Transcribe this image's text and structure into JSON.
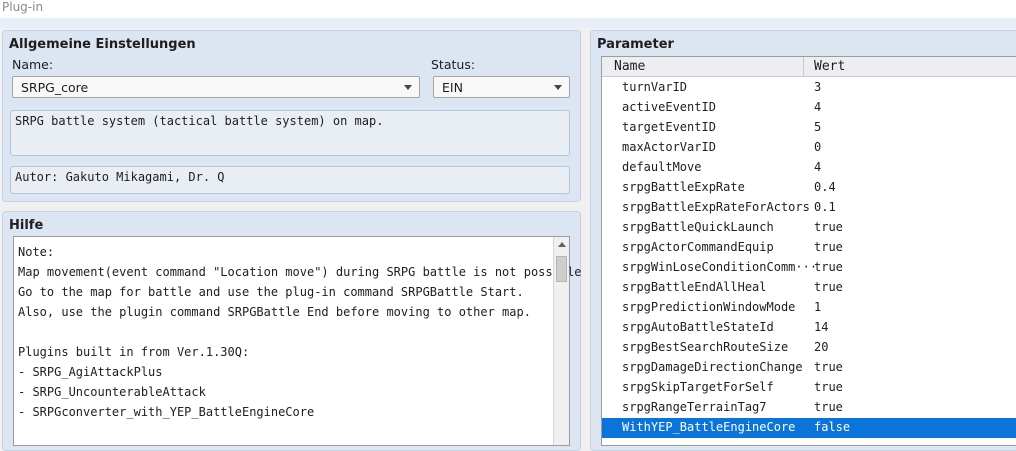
{
  "window": {
    "title": "Plug-in"
  },
  "general": {
    "title": "Allgemeine Einstellungen",
    "name_label": "Name:",
    "name_value": "SRPG_core",
    "status_label": "Status:",
    "status_value": "EIN",
    "description": "SRPG battle system (tactical battle system) on map.",
    "author": "Autor: Gakuto Mikagami, Dr. Q"
  },
  "help": {
    "title": "Hilfe",
    "lines": [
      "Note:",
      "Map movement(event command \"Location move\") during SRPG battle is not possible",
      "Go to the map for battle and use the plug-in command SRPGBattle Start.",
      "Also, use the plugin command SRPGBattle End before moving to other map.",
      "",
      "Plugins built in from Ver.1.30Q:",
      "- SRPG_AgiAttackPlus",
      "- SRPG_UncounterableAttack",
      "- SRPGconverter_with_YEP_BattleEngineCore"
    ]
  },
  "params": {
    "title": "Parameter",
    "col_name": "Name",
    "col_value": "Wert",
    "selected_index": 17,
    "rows": [
      {
        "name": "turnVarID",
        "value": "3"
      },
      {
        "name": "activeEventID",
        "value": "4"
      },
      {
        "name": "targetEventID",
        "value": "5"
      },
      {
        "name": "maxActorVarID",
        "value": "0"
      },
      {
        "name": "defaultMove",
        "value": "4"
      },
      {
        "name": "srpgBattleExpRate",
        "value": "0.4"
      },
      {
        "name": "srpgBattleExpRateForActors",
        "value": "0.1"
      },
      {
        "name": "srpgBattleQuickLaunch",
        "value": "true"
      },
      {
        "name": "srpgActorCommandEquip",
        "value": "true"
      },
      {
        "name": "srpgWinLoseConditionComm···",
        "value": "true"
      },
      {
        "name": "srpgBattleEndAllHeal",
        "value": "true"
      },
      {
        "name": "srpgPredictionWindowMode",
        "value": "1"
      },
      {
        "name": "srpgAutoBattleStateId",
        "value": "14"
      },
      {
        "name": "srpgBestSearchRouteSize",
        "value": "20"
      },
      {
        "name": "srpgDamageDirectionChange",
        "value": "true"
      },
      {
        "name": "srpgSkipTargetForSelf",
        "value": "true"
      },
      {
        "name": "srpgRangeTerrainTag7",
        "value": "true"
      },
      {
        "name": "WithYEP_BattleEngineCore",
        "value": "false"
      }
    ]
  }
}
